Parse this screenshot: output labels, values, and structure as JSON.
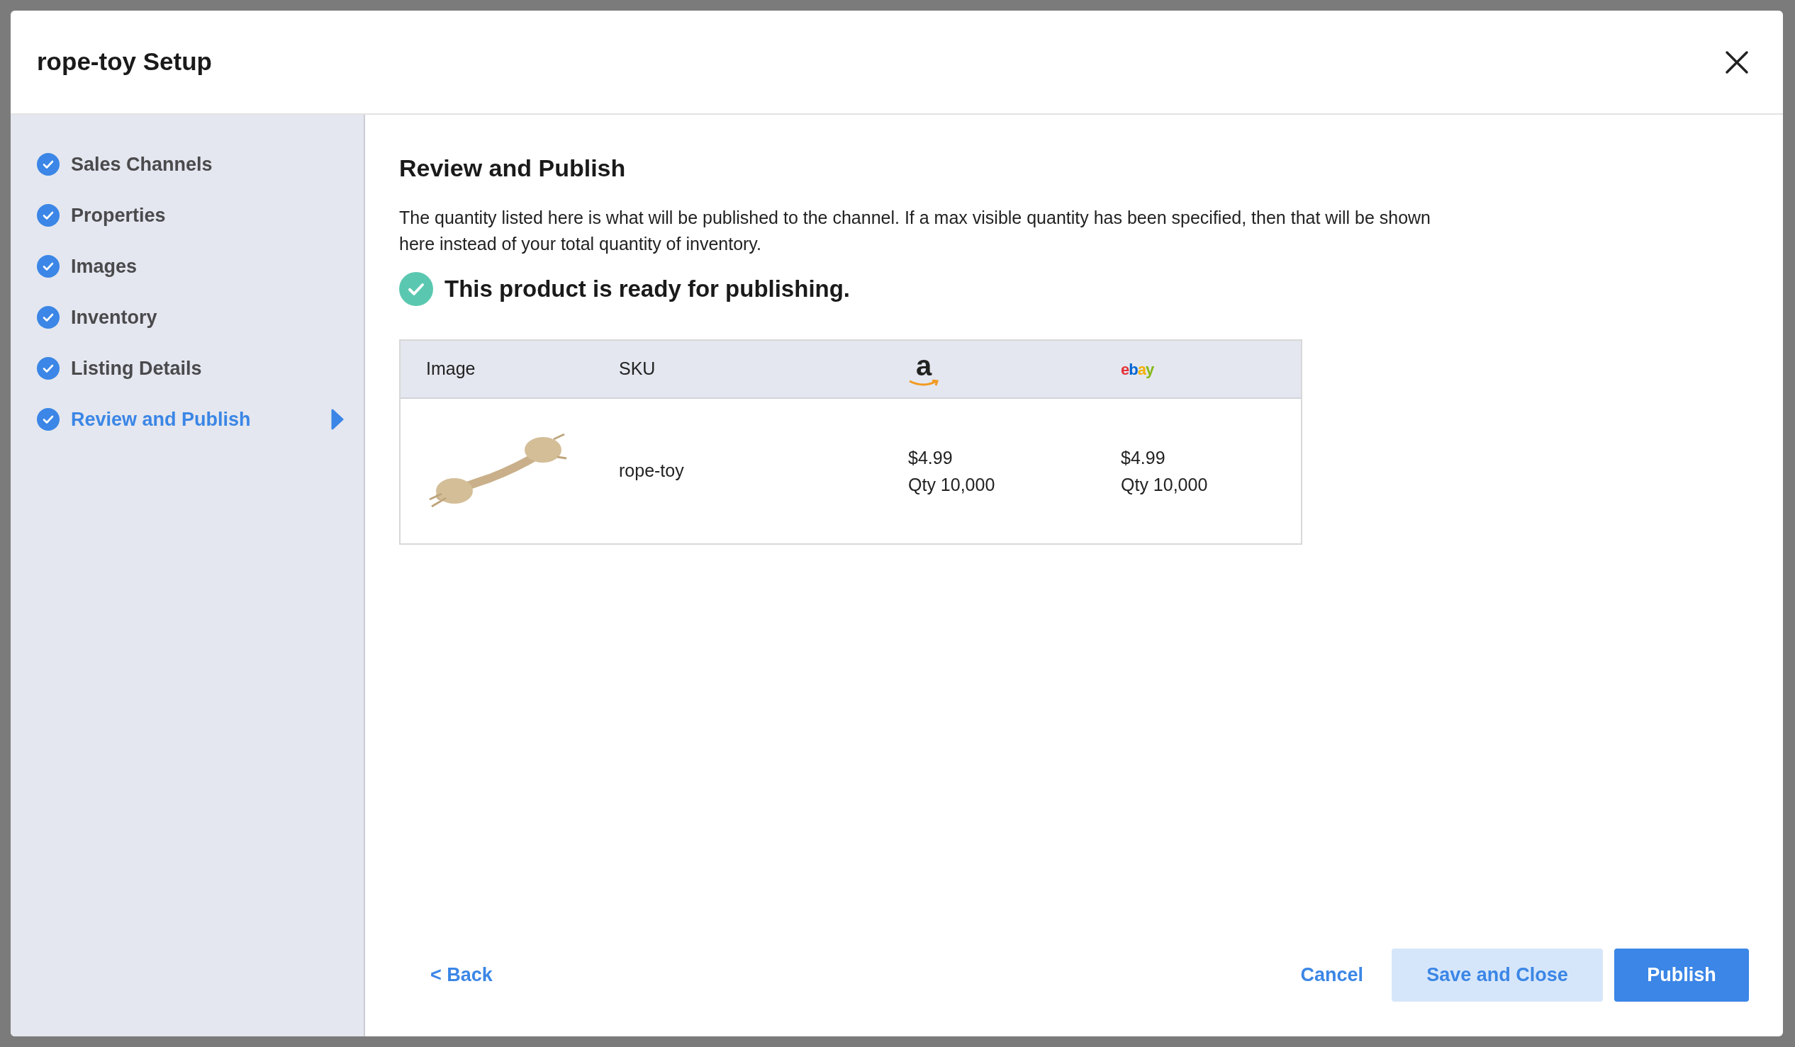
{
  "dialog": {
    "title": "rope-toy Setup"
  },
  "steps": [
    {
      "label": "Sales Channels",
      "completed": true,
      "selected": false
    },
    {
      "label": "Properties",
      "completed": true,
      "selected": false
    },
    {
      "label": "Images",
      "completed": true,
      "selected": false
    },
    {
      "label": "Inventory",
      "completed": true,
      "selected": false
    },
    {
      "label": "Listing Details",
      "completed": true,
      "selected": false
    },
    {
      "label": "Review and Publish",
      "completed": true,
      "selected": true
    }
  ],
  "content": {
    "heading": "Review and Publish",
    "description": "The quantity listed here is what will be published to the channel. If a max visible quantity has been specified, then that will be shown here instead of your total quantity of inventory.",
    "status": {
      "text": "This product is ready for publishing.",
      "ready": true
    }
  },
  "table": {
    "columns": [
      {
        "kind": "text",
        "label": "Image"
      },
      {
        "kind": "text",
        "label": "SKU"
      },
      {
        "kind": "amazon",
        "label": "a"
      },
      {
        "kind": "ebay",
        "label": "ebay"
      }
    ],
    "rows": [
      {
        "sku": "rope-toy",
        "channels": [
          {
            "price": "$4.99",
            "qty": "Qty 10,000"
          },
          {
            "price": "$4.99",
            "qty": "Qty 10,000"
          }
        ]
      }
    ]
  },
  "footer": {
    "back": "< Back",
    "cancel": "Cancel",
    "save_close": "Save and Close",
    "publish": "Publish"
  }
}
